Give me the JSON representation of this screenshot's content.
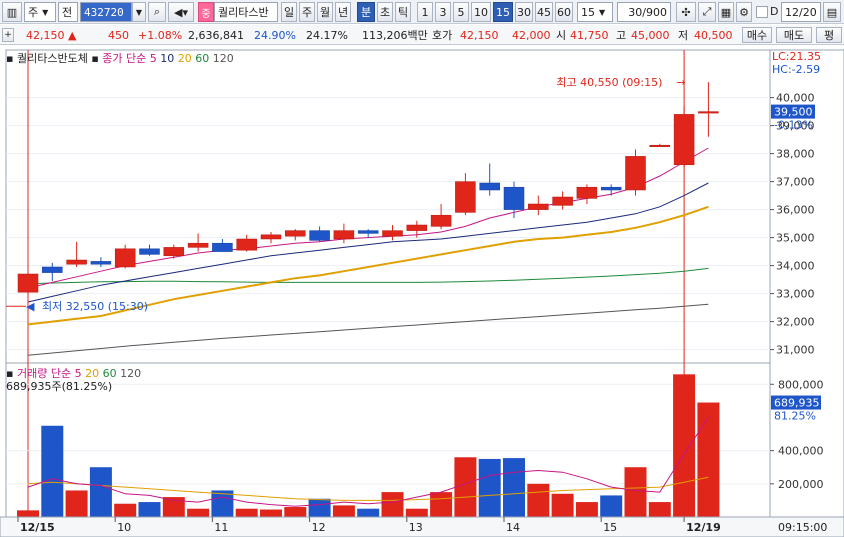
{
  "toolbar": {
    "mode1": "주",
    "mode2": "전",
    "code": "432720",
    "name": "퀄리타스반",
    "periods": [
      "일",
      "주",
      "월",
      "년",
      "분",
      "초",
      "틱"
    ],
    "intervals": [
      "1",
      "3",
      "5",
      "10",
      "15",
      "30",
      "45",
      "60"
    ],
    "interval_select": "15",
    "count": "30/900",
    "date_label": "D",
    "date": "12/20"
  },
  "info": {
    "price": "42,150",
    "price_arrow": "▲",
    "change": "450",
    "change_pct": "+1.08%",
    "volume": "2,636,841",
    "vol_ratio": "24.90%",
    "turnover": "24.17%",
    "amount": "113,206백만",
    "bid_label": "호가",
    "ask": "42,150",
    "bid": "42,000",
    "open_label": "시",
    "open": "41,750",
    "high_label": "고",
    "high": "45,000",
    "low_label": "저",
    "low": "40,500",
    "buy_label": "매수",
    "sell_label": "매도",
    "eval_label": "평"
  },
  "colors": {
    "up": "#e0251b",
    "down": "#1e55c8",
    "ma5": "#c71585",
    "ma10": "#1a2a7a",
    "ma20": "#e0a000",
    "ma60": "#1e8a3c",
    "ma120": "#555555"
  },
  "chart_data": [
    {
      "type": "candlestick",
      "title": "퀄리타스반도체",
      "legend": [
        "종가 단순 5",
        "10",
        "20",
        "60",
        "120"
      ],
      "y_axis": [
        "40,000",
        "39,000",
        "38,000",
        "37,000",
        "36,000",
        "35,000",
        "34,000",
        "33,000",
        "32,000",
        "31,000"
      ],
      "ylim": [
        30700,
        41200
      ],
      "lc": "LC:21.35",
      "hc": "HC:-2.59",
      "current_label": "39,500",
      "current_pct": "-0.13%",
      "high_note": "최고 40,550 (09:15)",
      "low_note": "최저 32,550 (15:30)",
      "candles": [
        {
          "o": 33050,
          "h": 34150,
          "l": 32550,
          "c": 33700
        },
        {
          "o": 33950,
          "h": 34100,
          "l": 33450,
          "c": 33750
        },
        {
          "o": 34050,
          "h": 34850,
          "l": 33950,
          "c": 34200
        },
        {
          "o": 34150,
          "h": 34300,
          "l": 33950,
          "c": 34050
        },
        {
          "o": 33950,
          "h": 34750,
          "l": 33900,
          "c": 34600
        },
        {
          "o": 34600,
          "h": 34750,
          "l": 34350,
          "c": 34400
        },
        {
          "o": 34350,
          "h": 34750,
          "l": 34250,
          "c": 34650
        },
        {
          "o": 34650,
          "h": 35150,
          "l": 34500,
          "c": 34800
        },
        {
          "o": 34800,
          "h": 34950,
          "l": 34600,
          "c": 34500
        },
        {
          "o": 34550,
          "h": 35100,
          "l": 34500,
          "c": 34950
        },
        {
          "o": 34950,
          "h": 35200,
          "l": 34800,
          "c": 35100
        },
        {
          "o": 35050,
          "h": 35300,
          "l": 34900,
          "c": 35250
        },
        {
          "o": 35250,
          "h": 35400,
          "l": 34850,
          "c": 34900
        },
        {
          "o": 34950,
          "h": 35500,
          "l": 34800,
          "c": 35250
        },
        {
          "o": 35250,
          "h": 35300,
          "l": 35000,
          "c": 35150
        },
        {
          "o": 35050,
          "h": 35450,
          "l": 34900,
          "c": 35250
        },
        {
          "o": 35250,
          "h": 35600,
          "l": 35000,
          "c": 35450
        },
        {
          "o": 35400,
          "h": 36200,
          "l": 35300,
          "c": 35800
        },
        {
          "o": 35900,
          "h": 37300,
          "l": 35800,
          "c": 37000
        },
        {
          "o": 36950,
          "h": 37650,
          "l": 36500,
          "c": 36700
        },
        {
          "o": 36800,
          "h": 37000,
          "l": 35700,
          "c": 36000
        },
        {
          "o": 36000,
          "h": 36500,
          "l": 35800,
          "c": 36200
        },
        {
          "o": 36150,
          "h": 36650,
          "l": 36000,
          "c": 36450
        },
        {
          "o": 36400,
          "h": 36900,
          "l": 36200,
          "c": 36800
        },
        {
          "o": 36800,
          "h": 36900,
          "l": 36500,
          "c": 36700
        },
        {
          "o": 36700,
          "h": 38150,
          "l": 36500,
          "c": 37900
        },
        {
          "o": 38300,
          "h": 38350,
          "l": 38300,
          "c": 38300
        },
        {
          "o": 37600,
          "h": 39700,
          "l": 37500,
          "c": 39400
        },
        {
          "o": 39500,
          "h": 40550,
          "l": 38600,
          "c": 39500
        }
      ],
      "ma5": [
        33200,
        33400,
        33600,
        33800,
        34000,
        34150,
        34300,
        34450,
        34550,
        34600,
        34700,
        34800,
        34850,
        34950,
        35000,
        35050,
        35100,
        35200,
        35400,
        35700,
        35900,
        36100,
        36250,
        36400,
        36550,
        36800,
        37200,
        37700,
        38200
      ],
      "ma10": [
        32700,
        32900,
        33100,
        33300,
        33450,
        33600,
        33750,
        33900,
        34050,
        34200,
        34350,
        34450,
        34550,
        34650,
        34750,
        34850,
        34900,
        34950,
        35050,
        35150,
        35250,
        35350,
        35450,
        35550,
        35700,
        35850,
        36100,
        36500,
        36950
      ],
      "ma20": [
        31900,
        32000,
        32100,
        32200,
        32400,
        32600,
        32800,
        32950,
        33100,
        33250,
        33400,
        33550,
        33650,
        33800,
        33950,
        34100,
        34250,
        34400,
        34550,
        34700,
        34850,
        34950,
        35000,
        35100,
        35200,
        35350,
        35550,
        35800,
        36100
      ],
      "ma60": [
        33350,
        33380,
        33400,
        33420,
        33430,
        33440,
        33440,
        33430,
        33420,
        33410,
        33400,
        33400,
        33400,
        33400,
        33400,
        33400,
        33400,
        33410,
        33430,
        33450,
        33480,
        33510,
        33550,
        33590,
        33630,
        33680,
        33730,
        33800,
        33900
      ],
      "ma120": [
        30800,
        30880,
        30960,
        31040,
        31120,
        31190,
        31260,
        31330,
        31400,
        31460,
        31520,
        31580,
        31640,
        31700,
        31760,
        31820,
        31880,
        31940,
        32000,
        32060,
        32120,
        32180,
        32240,
        32300,
        32360,
        32420,
        32480,
        32550,
        32620
      ]
    },
    {
      "type": "bar",
      "title": "거래량",
      "legend": [
        "단순 5",
        "20",
        "60",
        "120"
      ],
      "summary": "689,935주(81.25%)",
      "y_axis": [
        "800,000",
        "400,000",
        "200,000"
      ],
      "ylim": [
        0,
        880000
      ],
      "current_label": "689,935",
      "current_pct": "81.25%",
      "values": [
        40000,
        550000,
        160000,
        300000,
        80000,
        90000,
        120000,
        50000,
        160000,
        50000,
        45000,
        60000,
        110000,
        70000,
        50000,
        150000,
        50000,
        150000,
        360000,
        350000,
        355000,
        200000,
        140000,
        90000,
        130000,
        300000,
        90000,
        860000,
        689935
      ],
      "ma5": [
        180000,
        230000,
        200000,
        190000,
        140000,
        130000,
        100000,
        90000,
        120000,
        90000,
        75000,
        65000,
        75000,
        90000,
        80000,
        90000,
        120000,
        150000,
        200000,
        250000,
        270000,
        280000,
        270000,
        230000,
        180000,
        160000,
        150000,
        380000,
        600000
      ],
      "ma20": [
        200000,
        210000,
        200000,
        190000,
        180000,
        170000,
        160000,
        150000,
        140000,
        130000,
        120000,
        110000,
        105000,
        100000,
        100000,
        100000,
        105000,
        110000,
        120000,
        130000,
        140000,
        150000,
        160000,
        165000,
        170000,
        175000,
        180000,
        210000,
        240000
      ]
    }
  ],
  "x_labels": [
    "12/15",
    "10",
    "11",
    "12",
    "13",
    "14",
    "15",
    "12/19"
  ],
  "time_label": "09:15:00"
}
